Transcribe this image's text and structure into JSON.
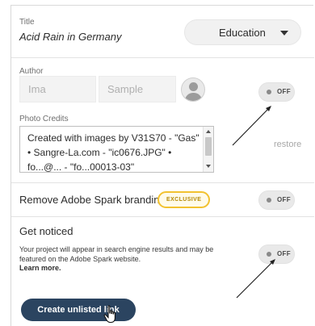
{
  "title": {
    "label": "Title",
    "value": "Acid Rain in Germany"
  },
  "category": {
    "selected": "Education"
  },
  "author": {
    "label": "Author",
    "first_name_placeholder": "Ima",
    "last_name_placeholder": "Sample",
    "toggle_state": "OFF"
  },
  "photo_credits": {
    "label": "Photo Credits",
    "text": "Created with images by V31S70 - \"Gas\" • Sangre-La.com - \"ic0676.JPG\" • fo...@... - \"fo...00013-03\"",
    "restore_label": "restore"
  },
  "branding": {
    "label": "Remove Adobe Spark branding",
    "badge": "EXCLUSIVE",
    "toggle_state": "OFF"
  },
  "get_noticed": {
    "label": "Get noticed",
    "description": "Your project will appear in search engine results and may be featured on the Adobe Spark website.",
    "learn_more": "Learn more.",
    "toggle_state": "OFF"
  },
  "create_link_button": "Create unlisted link",
  "colors": {
    "button_bg": "#2b4460",
    "badge_border": "#f2c230",
    "arrow": "#222222"
  }
}
